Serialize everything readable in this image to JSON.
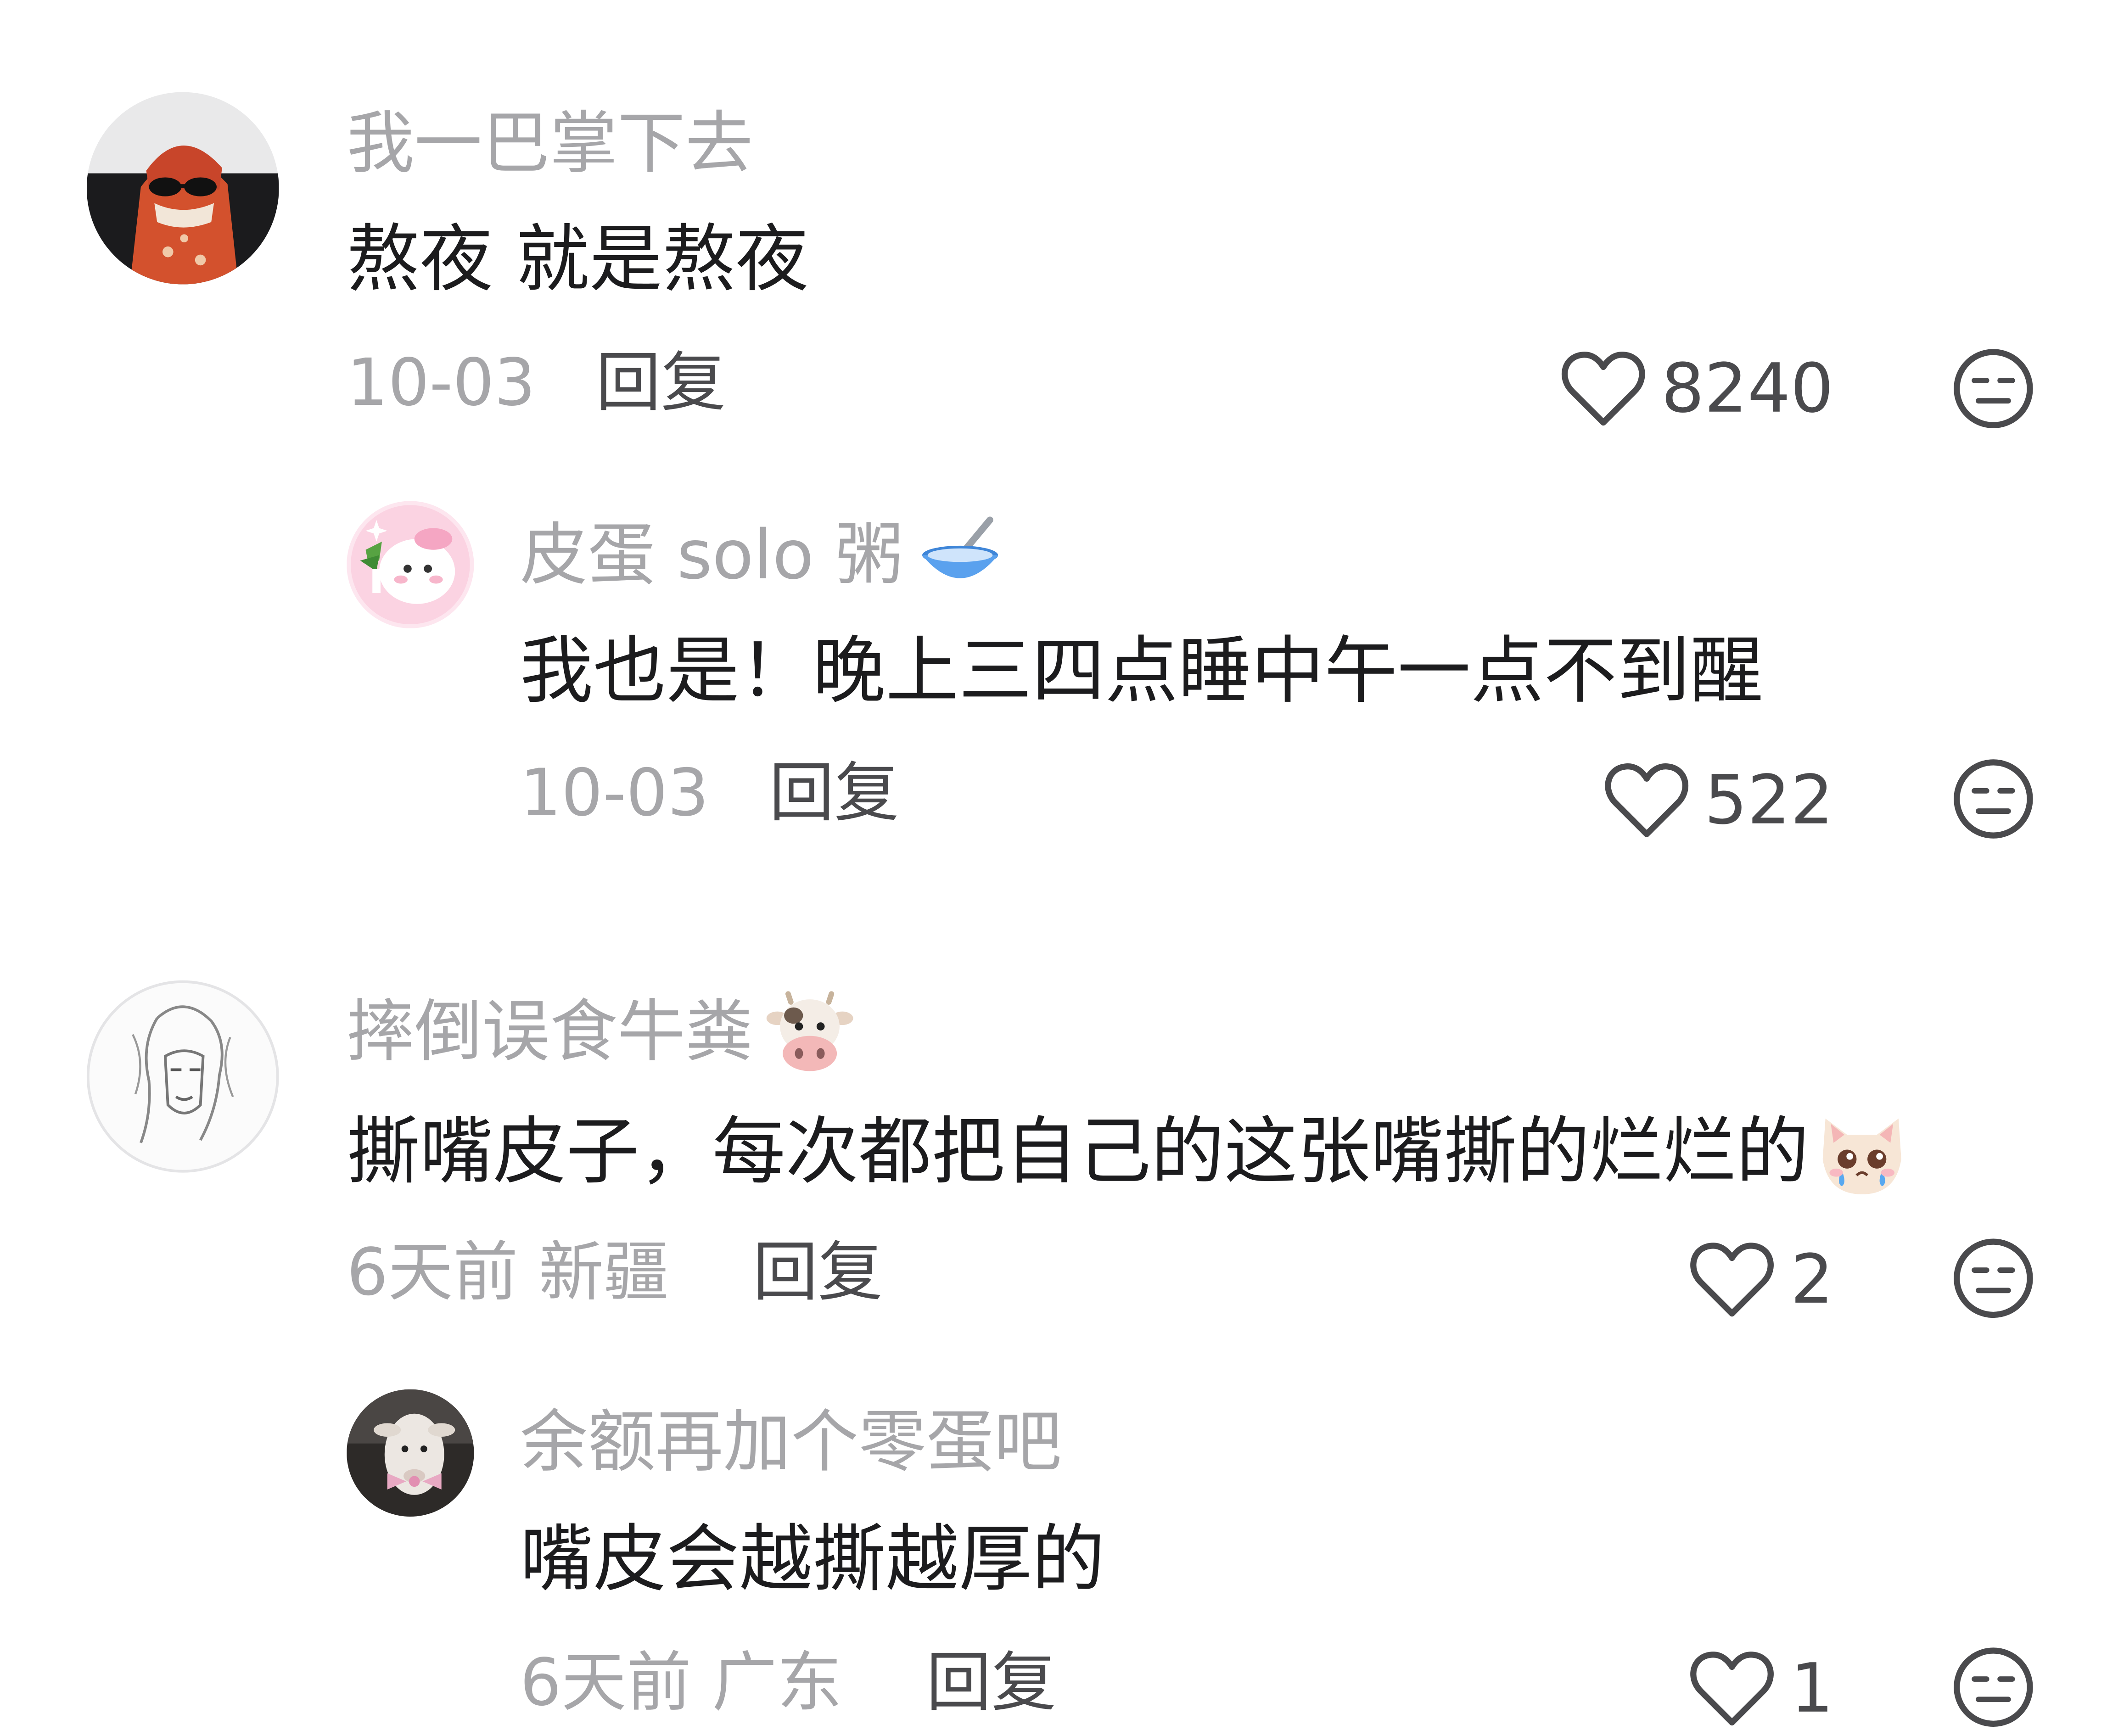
{
  "comments": [
    {
      "username": "我一巴掌下去",
      "text": "熬夜 就是熬夜",
      "date": "10-03",
      "reply_label": "回复",
      "likes": "8240",
      "avatar_icon": "cat-bandana-avatar-icon"
    },
    {
      "username": "皮蛋 solo 粥",
      "username_emoji": "bowl-with-spoon-icon",
      "text": "我也是！晚上三四点睡中午一点不到醒",
      "date": "10-03",
      "reply_label": "回复",
      "likes": "522",
      "avatar_icon": "pink-bunny-avatar-icon"
    },
    {
      "username": "摔倒误食牛粪",
      "username_emoji": "cow-face-icon",
      "text": "撕嘴皮子，每次都把自己的这张嘴撕的烂烂的",
      "text_emoji": "crying-cat-face-icon",
      "date": "6天前 新疆",
      "reply_label": "回复",
      "likes": "2",
      "avatar_icon": "sketch-character-avatar-icon"
    },
    {
      "username": "余额再加个零蛋吧",
      "text": "嘴皮会越撕越厚的",
      "date": "6天前 广东",
      "reply_label": "回复",
      "likes": "1",
      "avatar_icon": "sheep-ribbon-avatar-icon"
    }
  ],
  "colors": {
    "background": "#ffffff",
    "username": "#a6a6a9",
    "content": "#1c1c1e",
    "meta": "#a6a6a9",
    "reply": "#4a4a4d",
    "icon": "#4a4a4d"
  }
}
